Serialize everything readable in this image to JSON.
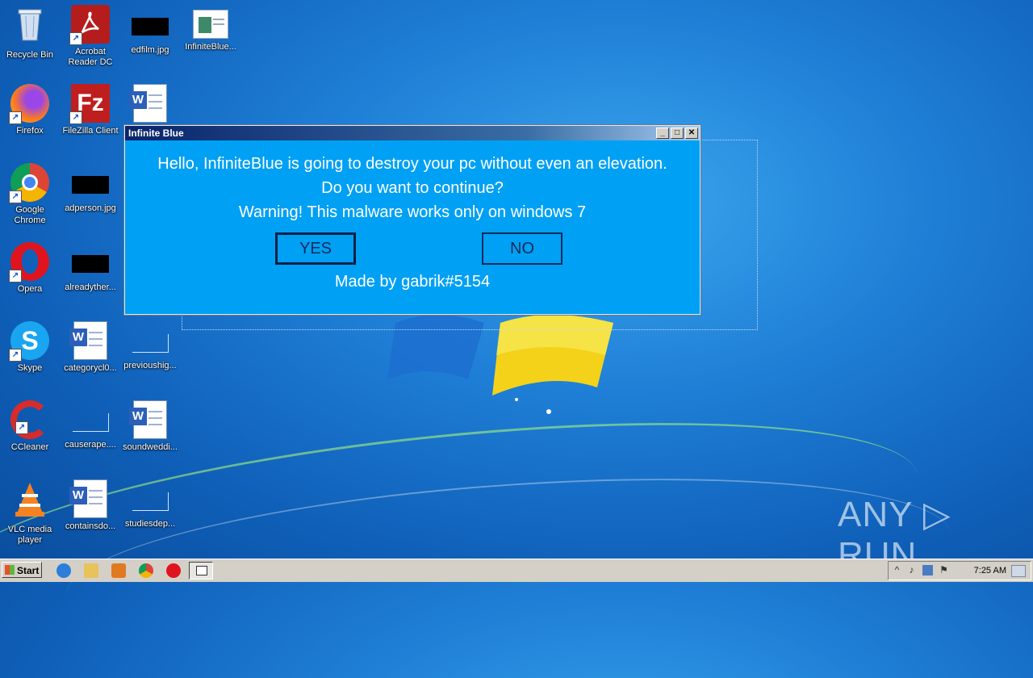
{
  "desktop": {
    "icons": [
      {
        "label": "Recycle Bin"
      },
      {
        "label": "Acrobat Reader DC"
      },
      {
        "label": "edfilm.jpg"
      },
      {
        "label": "InfiniteBlue..."
      },
      {
        "label": "Firefox"
      },
      {
        "label": "FileZilla Client"
      },
      {
        "label": "Google Chrome"
      },
      {
        "label": "adperson.jpg"
      },
      {
        "label": "Opera"
      },
      {
        "label": "alreadyther..."
      },
      {
        "label": "Skype"
      },
      {
        "label": "categorycl0..."
      },
      {
        "label": "previoushig..."
      },
      {
        "label": "CCleaner"
      },
      {
        "label": "causerape...."
      },
      {
        "label": "soundweddi..."
      },
      {
        "label": "VLC media player"
      },
      {
        "label": "containsdo..."
      },
      {
        "label": "studiesdep..."
      }
    ]
  },
  "dialog": {
    "title": "Infinite Blue",
    "line1": "Hello, InfiniteBlue is going to destroy your pc without even an elevation.",
    "line2": "Do you want to continue?",
    "line3": "Warning! This malware works only on windows 7",
    "yes_label": "YES",
    "no_label": "NO",
    "credit": "Made by gabrik#5154",
    "bg_color": "#00a0f4"
  },
  "watermark": "ANY ▷ RUN",
  "taskbar": {
    "start_label": "Start",
    "clock": "7:25 AM"
  }
}
